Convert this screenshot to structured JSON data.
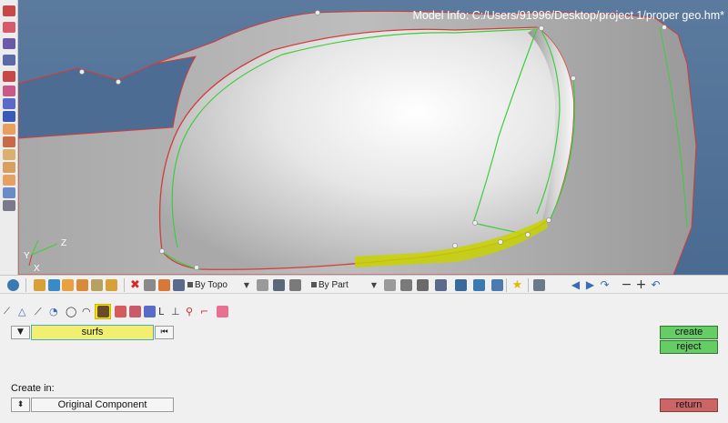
{
  "viewport": {
    "model_info": "Model Info: C:/Users/91996/Desktop/project 1/proper geo.hm*",
    "axis": {
      "y": "Y",
      "z": "Z",
      "x": "X"
    }
  },
  "toolbar": {
    "topology_dropdown": "By Topo",
    "part_dropdown": "By Part"
  },
  "panel": {
    "selector": "surfs",
    "create_in_label": "Create in:",
    "component_option": "Original Component",
    "create_label": "create",
    "reject_label": "reject",
    "return_label": "return"
  },
  "colors": {
    "background": "#4a6b91",
    "surface": "#d0d0d0",
    "edge_red": "#d23c3c",
    "edge_green": "#3ecc3e",
    "highlight_yellow": "#f4e400",
    "create_green": "#66cc66",
    "return_red": "#cc6666",
    "selector_yellow": "#f2ee70"
  },
  "icons": {
    "left": [
      "surface-icon",
      "surface-edit-icon",
      "solid-icon",
      "solid-edit-icon",
      "quick-edit-icon",
      "edge-edit-icon",
      "point-edit-icon",
      "autocleanup-icon",
      "defeature-icon",
      "midsurface-icon",
      "dimensioning-icon",
      "numbers-icon",
      "fillet-icon",
      "line-edit-icon",
      "node-icon",
      "temp-nodes-icon"
    ],
    "main": [
      "settings-icon",
      "collector-icon",
      "component-icon",
      "assembly-icon",
      "load-collector-icon",
      "system-icon",
      "delete-icon",
      "mask-icon",
      "hide-icon",
      "find-icon",
      "topology-icon",
      "part-icon",
      "shaded-icon",
      "wireframe-icon",
      "mesh-lines-icon",
      "feature-lines-icon",
      "element-shrink-icon",
      "screen-icon",
      "star-icon",
      "grid-icon",
      "previous-view-icon",
      "next-view-icon",
      "rotate-icon",
      "zoom-out-icon",
      "zoom-in-icon",
      "fit-icon"
    ],
    "panel": [
      "line-icon",
      "triangle-icon",
      "arc-icon",
      "circle-icon",
      "spline-icon",
      "torus-icon",
      "surface-grid-icon",
      "ruled-icon",
      "skin-icon",
      "drag-icon",
      "spin-icon",
      "fillet-icon",
      "offset-icon",
      "normal-icon",
      "cone-icon",
      "square-icon"
    ]
  }
}
